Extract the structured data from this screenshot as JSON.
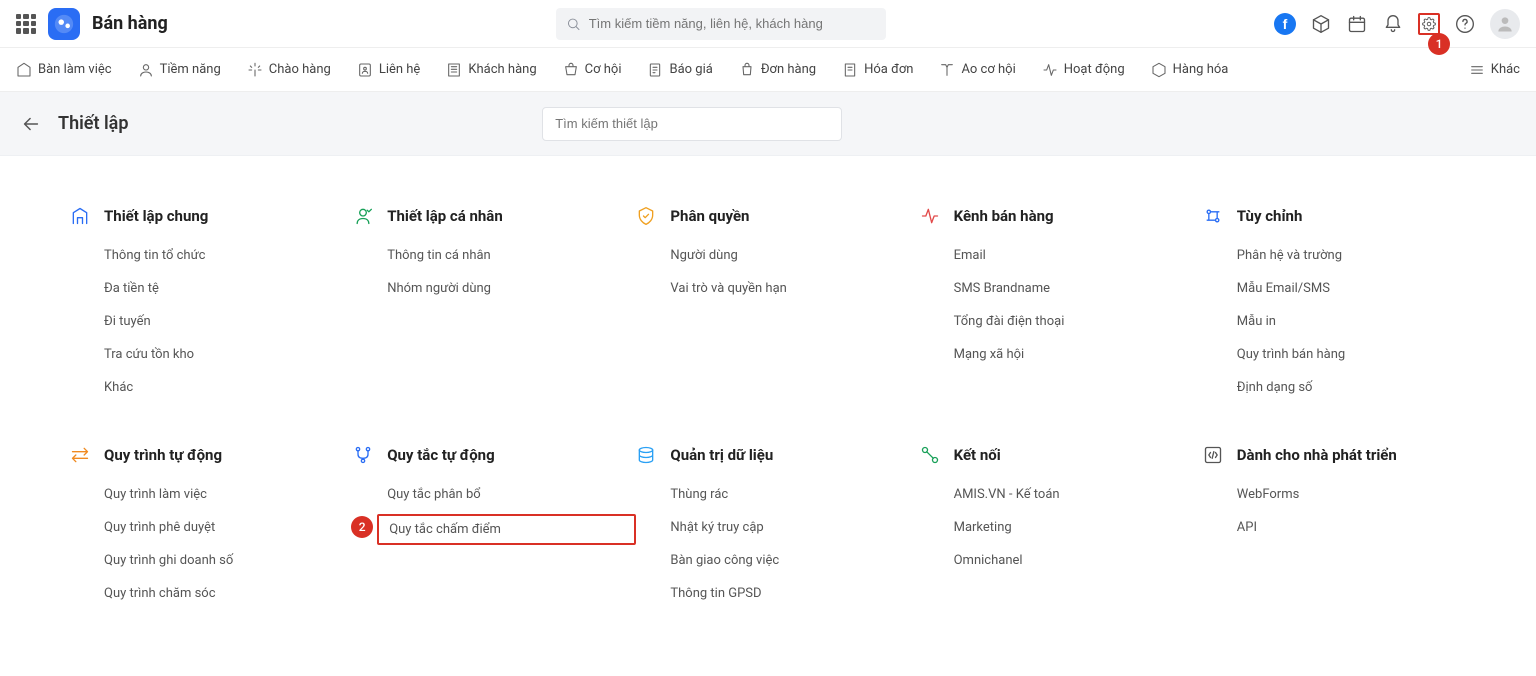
{
  "header": {
    "appTitle": "Bán hàng",
    "searchPlaceholder": "Tìm kiếm tiềm năng, liên hệ, khách hàng",
    "annotationBadge1": "1"
  },
  "nav": {
    "items": [
      {
        "label": "Bàn làm việc"
      },
      {
        "label": "Tiềm năng"
      },
      {
        "label": "Chào hàng"
      },
      {
        "label": "Liên hệ"
      },
      {
        "label": "Khách hàng"
      },
      {
        "label": "Cơ hội"
      },
      {
        "label": "Báo giá"
      },
      {
        "label": "Đơn hàng"
      },
      {
        "label": "Hóa đơn"
      },
      {
        "label": "Ao cơ hội"
      },
      {
        "label": "Hoạt động"
      },
      {
        "label": "Hàng hóa"
      },
      {
        "label": "Khác"
      }
    ]
  },
  "subheader": {
    "title": "Thiết lập",
    "searchPlaceholder": "Tìm kiếm thiết lập"
  },
  "sections": [
    {
      "title": "Thiết lập chung",
      "iconColor": "#2a6df4",
      "items": [
        "Thông tin tổ chức",
        "Đa tiền tệ",
        "Đi tuyến",
        "Tra cứu tồn kho",
        "Khác"
      ]
    },
    {
      "title": "Thiết lập cá nhân",
      "iconColor": "#18a058",
      "items": [
        "Thông tin cá nhân",
        "Nhóm người dùng"
      ]
    },
    {
      "title": "Phân quyền",
      "iconColor": "#f0a020",
      "items": [
        "Người dùng",
        "Vai trò và quyền hạn"
      ]
    },
    {
      "title": "Kênh bán hàng",
      "iconColor": "#e24a4a",
      "items": [
        "Email",
        "SMS Brandname",
        "Tổng đài điện thoại",
        "Mạng xã hội"
      ]
    },
    {
      "title": "Tùy chỉnh",
      "iconColor": "#2a6df4",
      "items": [
        "Phân hệ và trường",
        "Mẫu Email/SMS",
        "Mẫu in",
        "Quy trình bán hàng",
        "Định dạng số"
      ]
    },
    {
      "title": "Quy trình tự động",
      "iconColor": "#f08a20",
      "items": [
        "Quy trình làm việc",
        "Quy trình phê duyệt",
        "Quy trình ghi doanh số",
        "Quy trình chăm sóc"
      ]
    },
    {
      "title": "Quy tắc tự động",
      "iconColor": "#2a6df4",
      "items": [
        "Quy tắc phân bổ",
        "Quy tắc chấm điểm"
      ],
      "highlightIndex": 1,
      "badge": "2"
    },
    {
      "title": "Quản trị dữ liệu",
      "iconColor": "#2aa0f4",
      "items": [
        "Thùng rác",
        "Nhật ký truy cập",
        "Bàn giao công việc",
        "Thông tin GPSD"
      ]
    },
    {
      "title": "Kết nối",
      "iconColor": "#18a058",
      "items": [
        "AMIS.VN - Kế toán",
        "Marketing",
        "Omnichanel"
      ]
    },
    {
      "title": "Dành cho nhà phát triển",
      "iconColor": "#555",
      "items": [
        "WebForms",
        "API"
      ]
    }
  ]
}
